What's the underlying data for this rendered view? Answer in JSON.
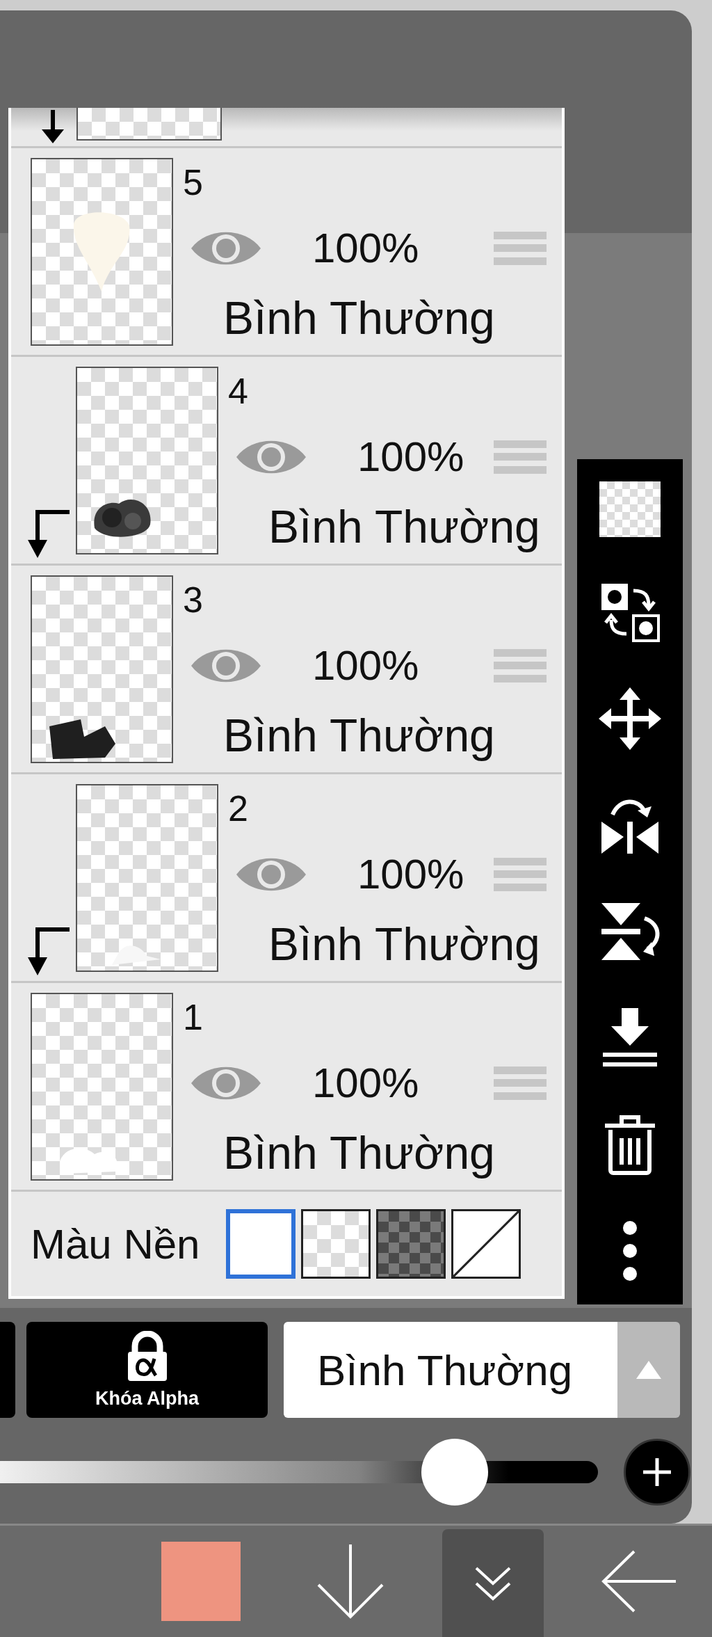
{
  "layer_panel": {
    "layers": [
      {
        "number": "5",
        "visible": true,
        "opacity": "100%",
        "blend_mode": "Bình Thường",
        "clipped": false
      },
      {
        "number": "4",
        "visible": true,
        "opacity": "100%",
        "blend_mode": "Bình Thường",
        "clipped": true
      },
      {
        "number": "3",
        "visible": true,
        "opacity": "100%",
        "blend_mode": "Bình Thường",
        "clipped": false
      },
      {
        "number": "2",
        "visible": true,
        "opacity": "100%",
        "blend_mode": "Bình Thường",
        "clipped": true
      },
      {
        "number": "1",
        "visible": true,
        "opacity": "100%",
        "blend_mode": "Bình Thường",
        "clipped": false
      }
    ]
  },
  "background_color": {
    "label": "Màu Nền",
    "options": [
      {
        "kind": "white",
        "selected": true
      },
      {
        "kind": "light-checker",
        "selected": false
      },
      {
        "kind": "dark-checker",
        "selected": false
      },
      {
        "kind": "none",
        "selected": false
      }
    ]
  },
  "alpha_lock_button": {
    "label": "Khóa Alpha"
  },
  "blend_mode_dropdown": {
    "value": "Bình Thường"
  },
  "opacity_slider": {
    "level": 0.76
  },
  "bottom_bar": {
    "color_swatch": {
      "color": "#ee9480"
    }
  }
}
